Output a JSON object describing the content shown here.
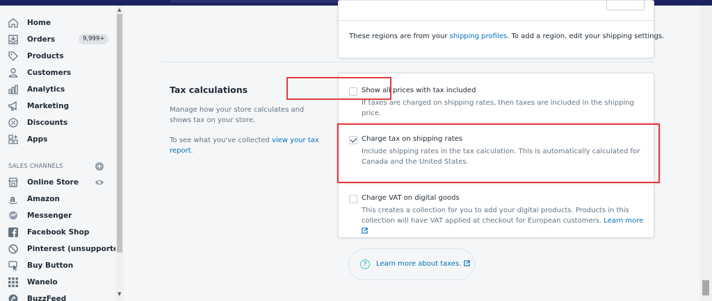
{
  "sidebar": {
    "items": [
      {
        "label": "Home",
        "icon": "home-icon"
      },
      {
        "label": "Orders",
        "icon": "orders-icon",
        "badge": "9,999+"
      },
      {
        "label": "Products",
        "icon": "tag-icon"
      },
      {
        "label": "Customers",
        "icon": "person-icon"
      },
      {
        "label": "Analytics",
        "icon": "bar-chart-icon"
      },
      {
        "label": "Marketing",
        "icon": "megaphone-icon"
      },
      {
        "label": "Discounts",
        "icon": "discount-icon"
      },
      {
        "label": "Apps",
        "icon": "apps-icon"
      }
    ],
    "sales_channels_title": "SALES CHANNELS",
    "channels": [
      {
        "label": "Online Store",
        "icon": "store-icon"
      },
      {
        "label": "Amazon",
        "icon": "amazon-icon"
      },
      {
        "label": "Messenger",
        "icon": "messenger-icon"
      },
      {
        "label": "Facebook Shop",
        "icon": "facebook-icon"
      },
      {
        "label": "Pinterest (unsupported)",
        "icon": "blocked-icon"
      },
      {
        "label": "Buy Button",
        "icon": "buy-button-icon"
      },
      {
        "label": "Wanelo",
        "icon": "wanelo-icon"
      },
      {
        "label": "BuzzFeed",
        "icon": "buzzfeed-icon"
      }
    ]
  },
  "regions_card": {
    "note_prefix": "These regions are from your ",
    "note_link": "shipping profiles",
    "note_suffix": ". To add a region, edit your shipping settings."
  },
  "tax_section": {
    "title": "Tax calculations",
    "description": "Manage how your store calculates and shows tax on your store.",
    "report_prefix": "To see what you've collected ",
    "report_link": "view your tax report",
    "report_suffix": "."
  },
  "tax_options": [
    {
      "label": "Show all prices with tax included",
      "help": "If taxes are charged on shipping rates, then taxes are included in the shipping price.",
      "checked": false
    },
    {
      "label": "Charge tax on shipping rates",
      "help": "Include shipping rates in the tax calculation. This is automatically calculated for Canada and the United States.",
      "checked": true
    },
    {
      "label": "Charge VAT on digital goods",
      "help": "This creates a collection for you to add your digital products. Products in this collection will have VAT applied at checkout for European customers.",
      "link": "Learn more",
      "checked": false
    }
  ],
  "learn_more": "Learn more about taxes.",
  "colors": {
    "nav_dark": "#1c2260",
    "link": "#006fbb",
    "highlight": "#e0393e",
    "teal": "#47c1bf"
  }
}
